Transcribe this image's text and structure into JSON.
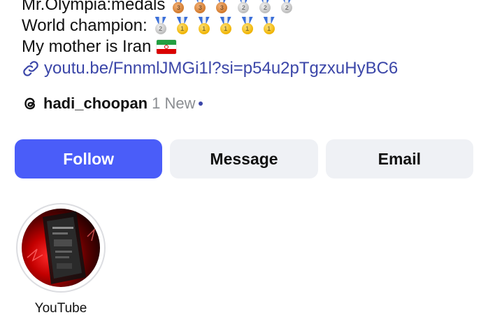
{
  "bio": {
    "medals_line": {
      "text": "Mr.Olympia:medals",
      "medals": [
        {
          "type": "bronze",
          "digit": "3"
        },
        {
          "type": "bronze",
          "digit": "3"
        },
        {
          "type": "bronze",
          "digit": "3"
        },
        {
          "type": "silver",
          "digit": "2"
        },
        {
          "type": "silver",
          "digit": "2"
        },
        {
          "type": "silver",
          "digit": "2"
        }
      ]
    },
    "champion_line": {
      "text": "World champion:",
      "medals": [
        {
          "type": "silver",
          "digit": "2"
        },
        {
          "type": "gold",
          "digit": "1"
        },
        {
          "type": "gold",
          "digit": "1"
        },
        {
          "type": "gold",
          "digit": "1"
        },
        {
          "type": "gold",
          "digit": "1"
        },
        {
          "type": "gold",
          "digit": "1"
        }
      ]
    },
    "iran_line": {
      "text": "My mother is Iran",
      "flag_icon": "iran-flag-icon"
    }
  },
  "link": {
    "icon": "link-icon",
    "text": "youtu.be/FnnmlJMGi1l?si=p54u2pTgzxuHyBC6"
  },
  "threads": {
    "icon": "threads-icon",
    "username": "hadi_choopan",
    "new_label": "1 New"
  },
  "actions": {
    "follow_label": "Follow",
    "message_label": "Message",
    "email_label": "Email"
  },
  "highlights": [
    {
      "label": "YouTube"
    }
  ],
  "colors": {
    "follow_bg": "#4a5df9",
    "secondary_bg": "#eff1f5",
    "link": "#3b46a8",
    "muted": "#8a8d91"
  }
}
